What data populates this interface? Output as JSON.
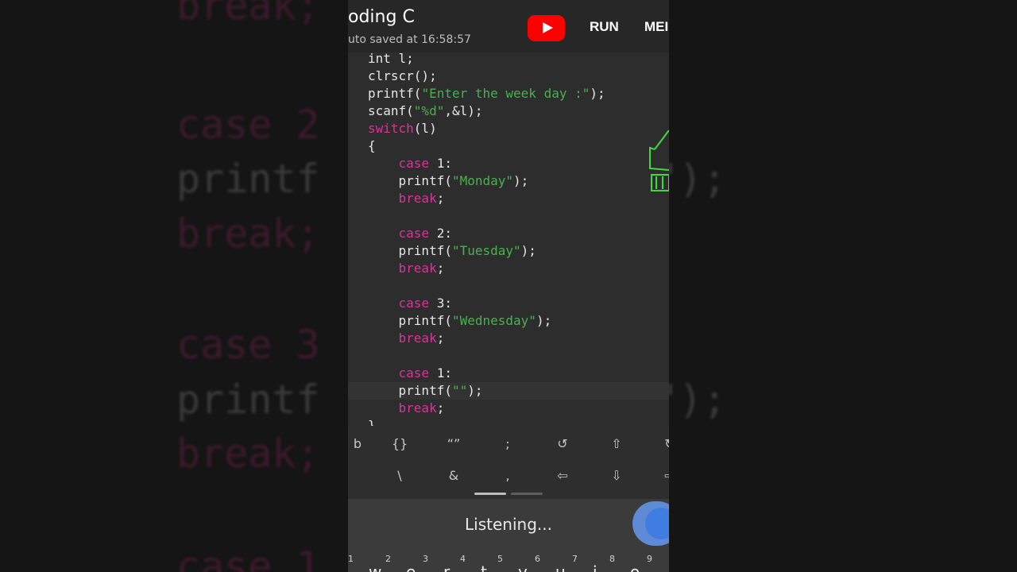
{
  "app": {
    "title": "oding C",
    "subtitle": "uto saved at 16:58:57",
    "run_label": "RUN",
    "menu_label": "MEI",
    "youtube_icon": "youtube-icon",
    "accent": "#ff0000"
  },
  "code": [
    {
      "parts": [
        {
          "t": "int l;",
          "c": "plain"
        }
      ]
    },
    {
      "parts": [
        {
          "t": "clrscr();",
          "c": "plain"
        }
      ]
    },
    {
      "parts": [
        {
          "t": "printf(",
          "c": "plain"
        },
        {
          "t": "\"Enter the week day :\"",
          "c": "str"
        },
        {
          "t": ");",
          "c": "plain"
        }
      ]
    },
    {
      "parts": [
        {
          "t": "scanf(",
          "c": "plain"
        },
        {
          "t": "\"%d\"",
          "c": "str"
        },
        {
          "t": ",&l);",
          "c": "plain"
        }
      ]
    },
    {
      "parts": [
        {
          "t": "switch",
          "c": "kw"
        },
        {
          "t": "(l)",
          "c": "plain"
        }
      ]
    },
    {
      "parts": [
        {
          "t": "{",
          "c": "plain"
        }
      ]
    },
    {
      "parts": [
        {
          "t": "    ",
          "c": "plain"
        },
        {
          "t": "case",
          "c": "kw"
        },
        {
          "t": " 1:",
          "c": "plain"
        }
      ]
    },
    {
      "parts": [
        {
          "t": "    printf(",
          "c": "plain"
        },
        {
          "t": "\"Monday\"",
          "c": "str"
        },
        {
          "t": ");",
          "c": "plain"
        }
      ]
    },
    {
      "parts": [
        {
          "t": "    ",
          "c": "plain"
        },
        {
          "t": "break",
          "c": "kw"
        },
        {
          "t": ";",
          "c": "plain"
        }
      ]
    },
    {
      "parts": [
        {
          "t": "",
          "c": "plain"
        }
      ]
    },
    {
      "parts": [
        {
          "t": "    ",
          "c": "plain"
        },
        {
          "t": "case",
          "c": "kw"
        },
        {
          "t": " 2:",
          "c": "plain"
        }
      ]
    },
    {
      "parts": [
        {
          "t": "    printf(",
          "c": "plain"
        },
        {
          "t": "\"Tuesday\"",
          "c": "str"
        },
        {
          "t": ");",
          "c": "plain"
        }
      ]
    },
    {
      "parts": [
        {
          "t": "    ",
          "c": "plain"
        },
        {
          "t": "break",
          "c": "kw"
        },
        {
          "t": ";",
          "c": "plain"
        }
      ]
    },
    {
      "parts": [
        {
          "t": "",
          "c": "plain"
        }
      ]
    },
    {
      "parts": [
        {
          "t": "    ",
          "c": "plain"
        },
        {
          "t": "case",
          "c": "kw"
        },
        {
          "t": " 3:",
          "c": "plain"
        }
      ]
    },
    {
      "parts": [
        {
          "t": "    printf(",
          "c": "plain"
        },
        {
          "t": "\"Wednesday\"",
          "c": "str"
        },
        {
          "t": ");",
          "c": "plain"
        }
      ]
    },
    {
      "parts": [
        {
          "t": "    ",
          "c": "plain"
        },
        {
          "t": "break",
          "c": "kw"
        },
        {
          "t": ";",
          "c": "plain"
        }
      ]
    },
    {
      "parts": [
        {
          "t": "",
          "c": "plain"
        }
      ]
    },
    {
      "parts": [
        {
          "t": "    ",
          "c": "plain"
        },
        {
          "t": "case",
          "c": "kw"
        },
        {
          "t": " 1:",
          "c": "plain"
        }
      ]
    },
    {
      "parts": [
        {
          "t": "    printf(",
          "c": "plain"
        },
        {
          "t": "\"\"",
          "c": "str"
        },
        {
          "t": ");",
          "c": "plain"
        }
      ]
    },
    {
      "parts": [
        {
          "t": "    ",
          "c": "plain"
        },
        {
          "t": "break",
          "c": "kw"
        },
        {
          "t": ";",
          "c": "plain"
        }
      ]
    },
    {
      "parts": [
        {
          "t": "}",
          "c": "plain"
        }
      ]
    }
  ],
  "symbols_row1": [
    "b",
    "{}",
    "“”",
    ";",
    "↺",
    "⇧",
    "↻"
  ],
  "symbols_row2": [
    "\\",
    "&",
    ",",
    "⇦",
    "⇩",
    "⇨"
  ],
  "voice": {
    "status": "Listening...",
    "mic_icon": "microphone-icon"
  },
  "keyboard": {
    "numbers": [
      "1",
      "2",
      "3",
      "4",
      "5",
      "6",
      "7",
      "8",
      "9"
    ],
    "letters": [
      "w",
      "e",
      "r",
      "t",
      "y",
      "u",
      "i",
      "o"
    ]
  },
  "background": {
    "left_lines": [
      "break;",
      "case 2",
      "printf",
      "break;",
      "case 3",
      "printf",
      "break;",
      "case 1"
    ],
    "right_lines": [
      "\");",
      "\");"
    ]
  }
}
